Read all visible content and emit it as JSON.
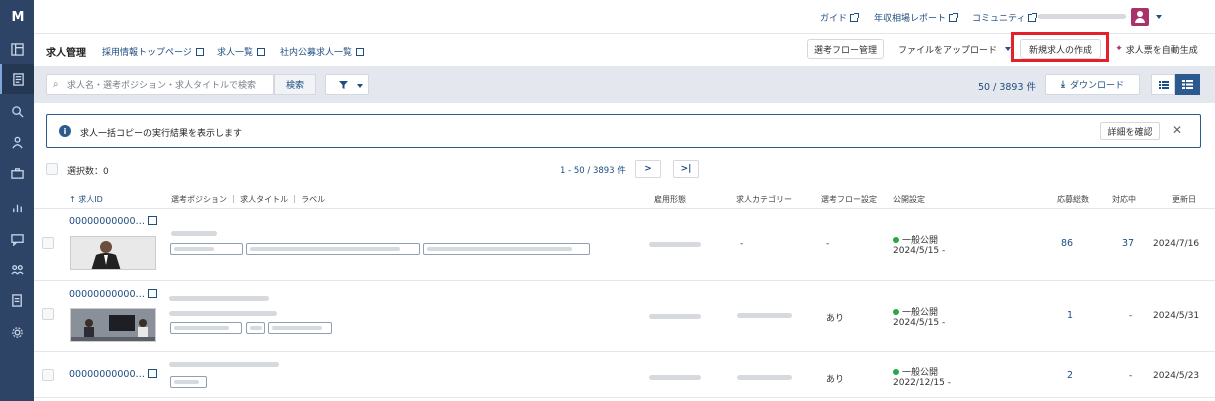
{
  "app": {
    "logo_text": "M"
  },
  "sidebar": {
    "items": [
      {
        "icon": "dashboard-icon"
      },
      {
        "icon": "job-posting-icon",
        "active": true
      },
      {
        "icon": "candidate-search-icon"
      },
      {
        "icon": "scout-icon"
      },
      {
        "icon": "briefcase-icon"
      },
      {
        "icon": "analytics-icon"
      },
      {
        "icon": "messages-icon"
      },
      {
        "icon": "team-icon"
      },
      {
        "icon": "documents-icon"
      },
      {
        "icon": "settings-icon"
      }
    ]
  },
  "topbar": {
    "links": [
      "ガイド",
      "年収相場レポート",
      "コミュニティ"
    ]
  },
  "subbar": {
    "title": "求人管理",
    "links": [
      "採用情報トップページ",
      "求人一覧",
      "社内公募求人一覧"
    ],
    "buttons": {
      "flow": "選考フロー管理",
      "upload": "ファイルをアップロード",
      "create": "新規求人の作成",
      "auto": "求人票を自動生成"
    }
  },
  "search": {
    "placeholder": "求人名・選考ポジション・求人タイトルで検索",
    "button": "検索",
    "count": "50 / 3893 件",
    "download": "ダウンロード"
  },
  "notice": {
    "message": "求人一括コピーの実行結果を表示します",
    "detail_button": "詳細を確認",
    "close": "✕"
  },
  "toolbar": {
    "selected": "選択数：0",
    "range": "1 - 50 / 3893 件",
    "next": ">",
    "last": ">|"
  },
  "table": {
    "headers": {
      "id": "↑ 求人ID",
      "position": "選考ポジション ｜ 求人タイトル ｜ ラベル",
      "employment": "雇用形態",
      "category": "求人カテゴリー",
      "flow": "選考フロー設定",
      "publish": "公開設定",
      "applicants": "応募総数",
      "active": "対応中",
      "updated": "更新日"
    },
    "rows": [
      {
        "id": "00000000000…",
        "category": "-",
        "flow": "-",
        "publish": "一般公開",
        "publish_date": "2024/5/15 -",
        "applicants": "86",
        "active": "37",
        "updated": "2024/7/16"
      },
      {
        "id": "00000000000…",
        "category": "",
        "flow": "あり",
        "publish": "一般公開",
        "publish_date": "2024/5/15 -",
        "applicants": "1",
        "active": "-",
        "updated": "2024/5/31"
      },
      {
        "id": "00000000000…",
        "category": "",
        "flow": "あり",
        "publish": "一般公開",
        "publish_date": "2022/12/15 -",
        "applicants": "2",
        "active": "-",
        "updated": "2024/5/23"
      }
    ]
  },
  "colors": {
    "sidebar": "#2e4466",
    "link": "#1f4e80",
    "highlight": "#e5202b",
    "published": "#27a745",
    "avatar": "#a8336b"
  }
}
